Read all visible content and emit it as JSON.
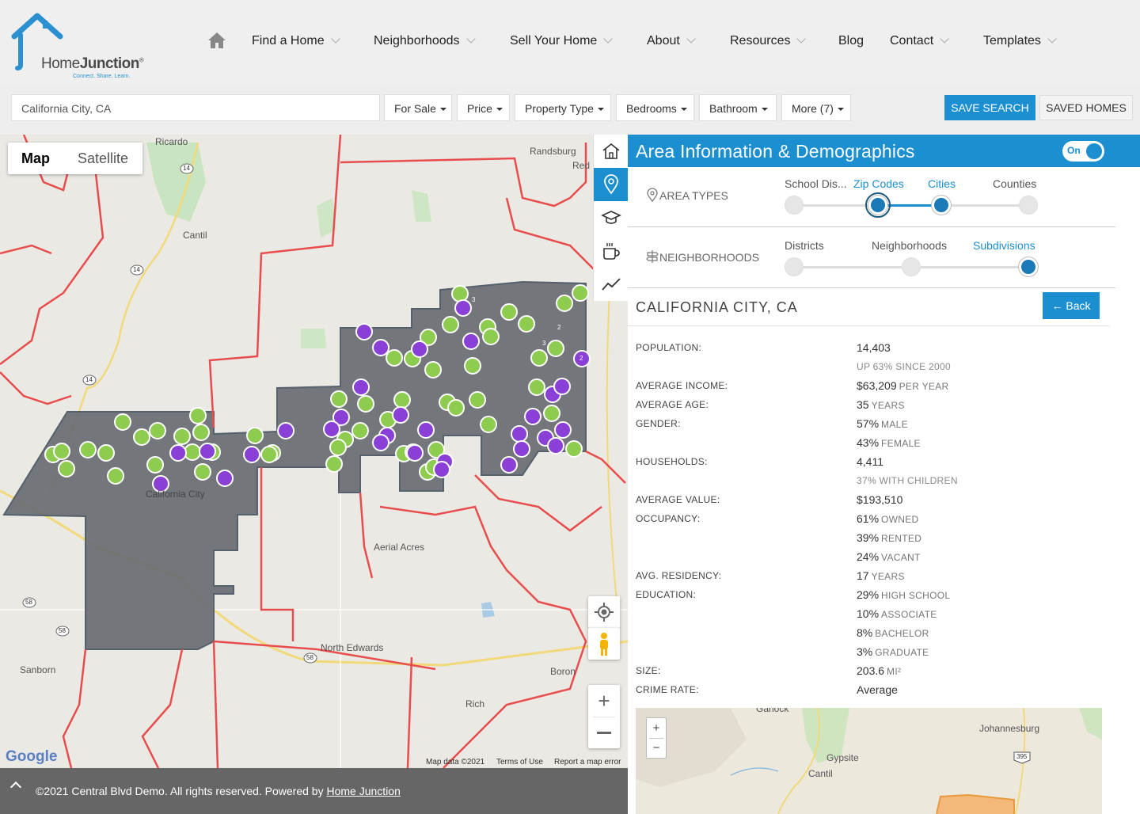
{
  "brand": {
    "name_part1": "Home",
    "name_part2": "Junction",
    "tagline": "Connect. Share. Learn."
  },
  "nav": {
    "items": [
      {
        "label": "Find a Home",
        "has_dropdown": true
      },
      {
        "label": "Neighborhoods",
        "has_dropdown": true
      },
      {
        "label": "Sell Your Home",
        "has_dropdown": true
      },
      {
        "label": "About",
        "has_dropdown": true
      },
      {
        "label": "Resources",
        "has_dropdown": true
      },
      {
        "label": "Blog",
        "has_dropdown": false
      },
      {
        "label": "Contact",
        "has_dropdown": true
      },
      {
        "label": "Templates",
        "has_dropdown": true
      }
    ]
  },
  "search": {
    "value": "California City, CA",
    "filters": [
      "For Sale",
      "Price",
      "Property Type",
      "Bedrooms",
      "Bathroom",
      "More (7)"
    ],
    "save_search": "SAVE SEARCH",
    "saved_homes": "SAVED HOMES"
  },
  "map": {
    "toggle": {
      "map": "Map",
      "satellite": "Satellite",
      "selected": "Map"
    },
    "places": [
      "Ricardo",
      "Randsburg",
      "Red",
      "Cantil",
      "California City",
      "Aerial Acres",
      "North Edwards",
      "Sanborn",
      "Boron",
      "Rich"
    ],
    "routes": [
      "14",
      "14",
      "14",
      "58",
      "58",
      "58"
    ],
    "cluster_badges": [
      "3",
      "2",
      "3",
      "2"
    ],
    "attribution": {
      "data": "Map data ©2021",
      "terms": "Terms of Use",
      "report": "Report a map error"
    },
    "google": "Google",
    "colors": {
      "boundary": "#e84d4d",
      "area_fill": "#6b6e73",
      "marker_green": "#8dcc4f",
      "marker_purple": "#8a3fd6"
    }
  },
  "tools": [
    "home-icon",
    "location-pin-icon",
    "graduation-cap-icon",
    "coffee-cup-icon",
    "trend-line-icon"
  ],
  "footer": {
    "text": "©2021 Central Blvd Demo. All rights reserved. Powered by ",
    "link": "Home Junction"
  },
  "panel": {
    "title": "Area Information & Demographics",
    "toggle": "On",
    "area_types": {
      "label": "AREA TYPES",
      "stops": [
        "School Dis...",
        "Zip Codes",
        "Cities",
        "Counties"
      ]
    },
    "neighborhoods": {
      "label": "NEIGHBORHOODS",
      "stops": [
        "Districts",
        "Neighborhoods",
        "Subdivisions"
      ]
    },
    "city": "CALIFORNIA CITY, CA",
    "back": "Back",
    "stats": {
      "population_label": "POPULATION:",
      "population": "14,403",
      "population_sub": "UP 63% SINCE 2000",
      "income_label": "AVERAGE INCOME:",
      "income": "$63,209",
      "income_unit": "PER YEAR",
      "age_label": "AVERAGE AGE:",
      "age": "35",
      "age_unit": "YEARS",
      "gender_label": "GENDER:",
      "male": "57%",
      "male_unit": "MALE",
      "female": "43%",
      "female_unit": "FEMALE",
      "households_label": "HOUSEHOLDS:",
      "households": "4,411",
      "households_sub": "37% WITH CHILDREN",
      "value_label": "AVERAGE VALUE:",
      "value": "$193,510",
      "occupancy_label": "OCCUPANCY:",
      "owned": "61%",
      "owned_unit": "OWNED",
      "rented": "39%",
      "rented_unit": "RENTED",
      "vacant": "24%",
      "vacant_unit": "VACANT",
      "residency_label": "AVG. RESIDENCY:",
      "residency": "17",
      "residency_unit": "YEARS",
      "education_label": "EDUCATION:",
      "hs": "29%",
      "hs_unit": "HIGH SCHOOL",
      "assoc": "10%",
      "assoc_unit": "ASSOCIATE",
      "bach": "8%",
      "bach_unit": "BACHELOR",
      "grad": "3%",
      "grad_unit": "GRADUATE",
      "size_label": "SIZE:",
      "size": "203.6",
      "size_unit": "MI²",
      "crime_label": "CRIME RATE:",
      "crime": "Average"
    },
    "mini_map": {
      "places": [
        "Garlock",
        "Johannesburg",
        "Gypsite",
        "Cantil"
      ],
      "route": "395"
    }
  }
}
